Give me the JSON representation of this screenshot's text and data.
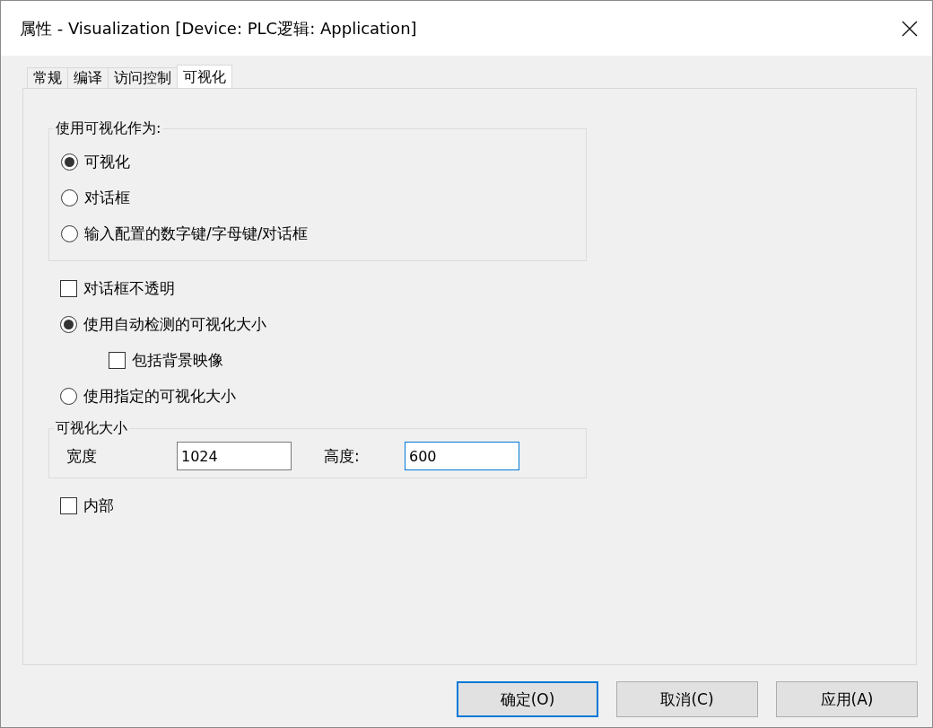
{
  "window": {
    "title": "属性 - Visualization [Device: PLC逻辑: Application]"
  },
  "tabs": [
    {
      "label": "常规",
      "selected": false
    },
    {
      "label": "编译",
      "selected": false
    },
    {
      "label": "访问控制",
      "selected": false
    },
    {
      "label": "可视化",
      "selected": true
    }
  ],
  "use_as_group": {
    "legend": "使用可视化作为:",
    "options": [
      {
        "label": "可视化",
        "selected": true
      },
      {
        "label": "对话框",
        "selected": false
      },
      {
        "label": "输入配置的数字键/字母键/对话框",
        "selected": false
      }
    ]
  },
  "options": [
    {
      "kind": "checkbox",
      "label": "对话框不透明",
      "checked": false
    },
    {
      "kind": "radio",
      "label": "使用自动检测的可视化大小",
      "selected": true,
      "children": [
        {
          "kind": "checkbox",
          "label": "包括背景映像",
          "checked": false
        }
      ]
    },
    {
      "kind": "radio",
      "label": "使用指定的可视化大小",
      "selected": false
    }
  ],
  "size_group": {
    "legend": "可视化大小",
    "fields": [
      {
        "label": "宽度",
        "value": "1024",
        "focused": false
      },
      {
        "label": "高度:",
        "value": "600",
        "focused": true
      }
    ]
  },
  "internal": {
    "label": "内部",
    "checked": false
  },
  "buttons": [
    {
      "label": "确定(O)",
      "default": true
    },
    {
      "label": "取消(C)",
      "default": false
    },
    {
      "label": "应用(A)",
      "default": false
    }
  ]
}
